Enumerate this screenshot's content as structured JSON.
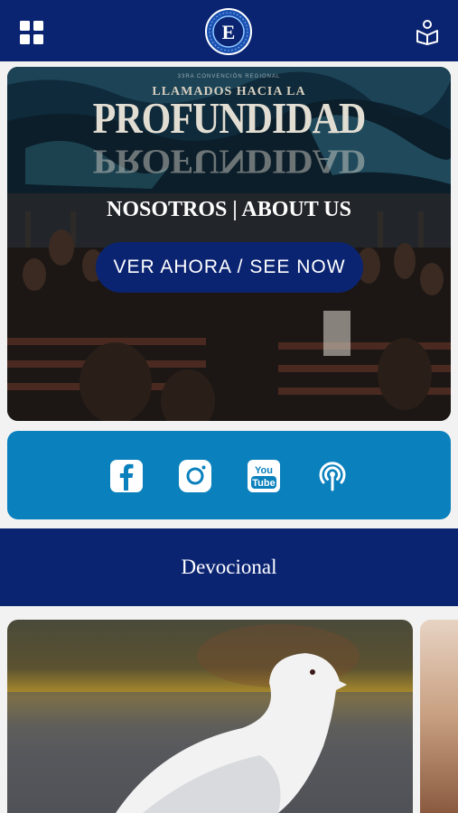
{
  "header": {
    "menu_icon": "grid-icon",
    "logo_letter": "E",
    "logo_ring_text": "CRISTO PARA TODOS",
    "reader_icon": "book-reader-icon"
  },
  "hero": {
    "eyebrow": "33RA CONVENCIÓN REGIONAL",
    "banner_pre": "LLAMADOS HACIA LA",
    "banner_main": "PROFUNDIDAD",
    "title": "NOSOTROS | ABOUT US",
    "button_label": "VER AHORA / SEE NOW"
  },
  "social": {
    "items": [
      {
        "name": "facebook",
        "icon": "facebook-icon"
      },
      {
        "name": "instagram",
        "icon": "instagram-icon"
      },
      {
        "name": "youtube",
        "icon": "youtube-icon",
        "text": "You Tube"
      },
      {
        "name": "podcast",
        "icon": "podcast-icon"
      }
    ]
  },
  "devotional": {
    "title": "Devocional"
  },
  "colors": {
    "navy": "#0b2472",
    "social_blue": "#0a80bd",
    "background": "#f2f2f2"
  }
}
